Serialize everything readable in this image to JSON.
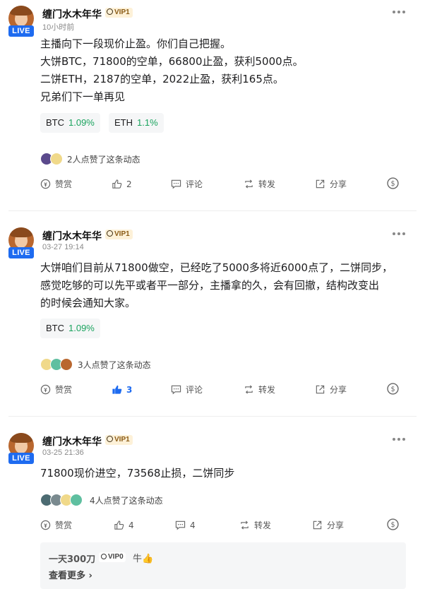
{
  "posts": [
    {
      "author": "缠门水木年华",
      "vip": "VIP1",
      "live": "LIVE",
      "time": "10小时前",
      "lines": [
        "主播向下一段现价止盈。你们自己把握。",
        "大饼BTC，71800的空单，66800止盈，获利5000点。",
        "二饼ETH，2187的空单，2022止盈，获利165点。",
        "兄弟们下一单再见"
      ],
      "tickers": [
        {
          "symbol": "BTC",
          "change": "1.09%"
        },
        {
          "symbol": "ETH",
          "change": "1.1%"
        }
      ],
      "likes_text": "2人点赞了这条动态",
      "actions": {
        "reward": "赞赏",
        "like": "2",
        "comment": "评论",
        "repost": "转发",
        "share": "分享"
      }
    },
    {
      "author": "缠门水木年华",
      "vip": "VIP1",
      "live": "LIVE",
      "time": "03-27 19:14",
      "lines": [
        "大饼咱们目前从71800做空，已经吃了5000多将近6000点了，二饼同步，",
        "感觉吃够的可以先平或者平一部分，主播拿的久，会有回撤，结构改变出",
        "的时候会通知大家。"
      ],
      "tickers": [
        {
          "symbol": "BTC",
          "change": "1.09%"
        }
      ],
      "likes_text": "3人点赞了这条动态",
      "actions": {
        "reward": "赞赏",
        "like": "3",
        "comment": "评论",
        "repost": "转发",
        "share": "分享"
      }
    },
    {
      "author": "缠门水木年华",
      "vip": "VIP1",
      "live": "LIVE",
      "time": "03-25 21:36",
      "lines": [
        "71800现价进空，73568止损，二饼同步"
      ],
      "tickers": [],
      "likes_text": "4人点赞了这条动态",
      "actions": {
        "reward": "赞赏",
        "like": "4",
        "comment": "4",
        "repost": "转发",
        "share": "分享"
      }
    }
  ],
  "comment": {
    "author": "一天300刀",
    "vip": "VIP0",
    "text": "牛👍",
    "view_more": "查看更多 ›"
  },
  "colors": {
    "accent": "#1e6bf0",
    "positive": "#1aa35e",
    "vip_bg": "#fdf1d8"
  }
}
